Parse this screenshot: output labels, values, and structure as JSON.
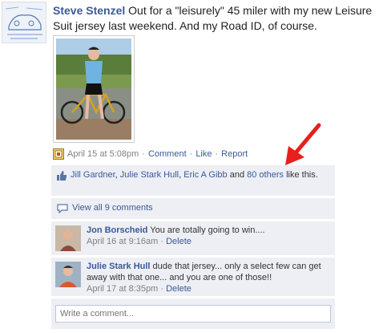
{
  "post": {
    "author": "Steve Stenzel",
    "text": " Out for a \"leisurely\" 45 miler with my new Leisure Suit jersey last weekend. And my Road ID, of course.",
    "timestamp": "April 15 at 5:08pm",
    "actions": {
      "comment": "Comment",
      "like": "Like",
      "report": "Report"
    },
    "separator": "·"
  },
  "likes": {
    "names": [
      "Jill Gardner",
      "Julie Stark Hull",
      "Eric A Gibb"
    ],
    "comma": ", ",
    "and_text": " and ",
    "others_link": "80 others",
    "suffix": " like this."
  },
  "view_all_comments": "View all 9 comments",
  "comments": [
    {
      "author": "Jon Borscheid",
      "text": " You are totally going to win....",
      "timestamp": "April 16 at 9:16am",
      "delete": "Delete"
    },
    {
      "author": "Julie Stark Hull",
      "text": " dude that jersey... only a select few can get away with that one... and you are one of those!!",
      "timestamp": "April 17 at 8:35pm",
      "delete": "Delete"
    }
  ],
  "write_comment": {
    "placeholder": "Write a comment..."
  },
  "colors": {
    "link": "#3b5998",
    "ufi_bg": "#edeff4",
    "annotation_arrow": "#e8201c"
  },
  "icons": {
    "app": "app-icon",
    "like": "thumbs-up-icon",
    "comments": "comment-bubble-icon",
    "annotation": "red-arrow-annotation"
  }
}
